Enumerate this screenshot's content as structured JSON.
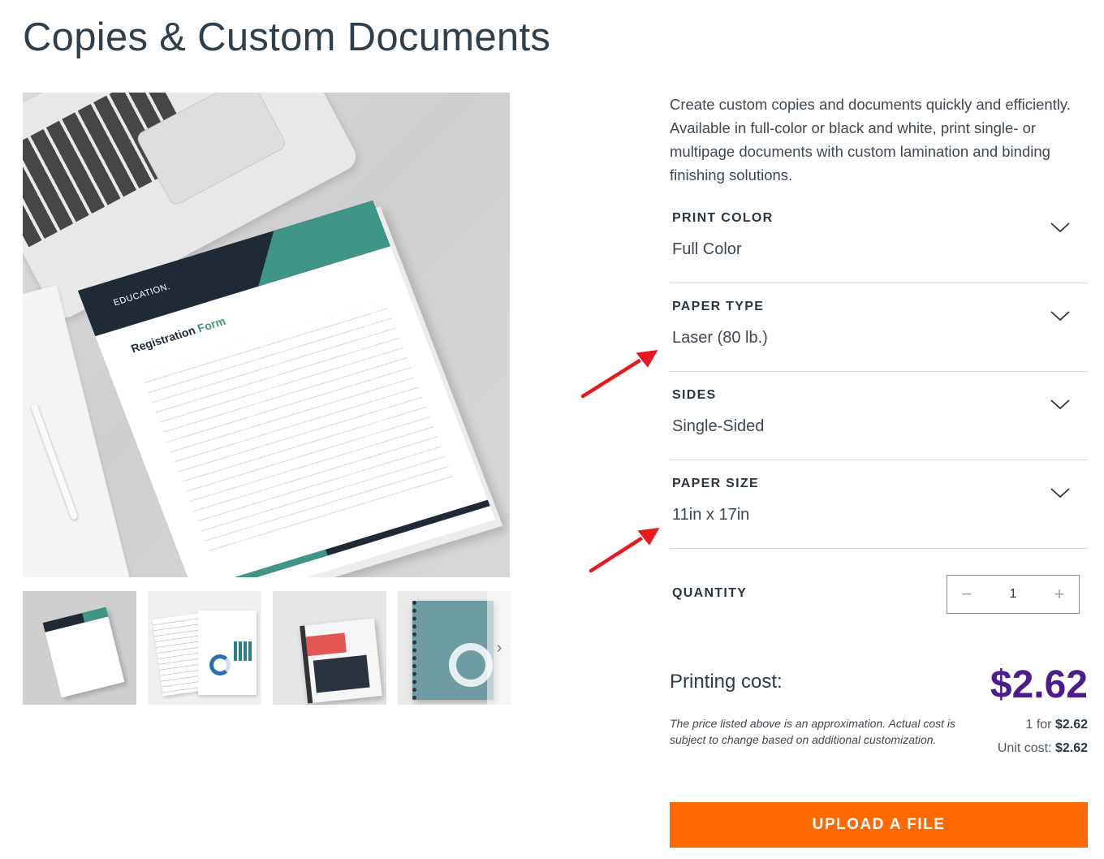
{
  "page": {
    "title": "Copies & Custom Documents"
  },
  "product": {
    "description": "Create custom copies and documents quickly and efficiently. Available in full-color or black and white, print single- or multipage documents with custom lamination and binding finishing solutions.",
    "hero_doc": {
      "brand": "EDUCATION.",
      "title_a": "Registration",
      "title_b": "Form"
    },
    "thumbnails": [
      "registration-form",
      "financial-projection",
      "business-proposal",
      "marketing-proposal"
    ]
  },
  "options": [
    {
      "label": "PRINT COLOR",
      "value": "Full Color"
    },
    {
      "label": "PAPER TYPE",
      "value": "Laser (80 lb.)"
    },
    {
      "label": "SIDES",
      "value": "Single-Sided"
    },
    {
      "label": "PAPER SIZE",
      "value": "11in x 17in"
    }
  ],
  "quantity": {
    "label": "QUANTITY",
    "value": "1",
    "minus": "−",
    "plus": "+"
  },
  "cost": {
    "label": "Printing cost:",
    "price": "$2.62",
    "disclaimer": "The price listed above is an approximation. Actual cost is subject to change based on additional customization.",
    "qty_text": "1 for",
    "qty_price": "$2.62",
    "unit_text": "Unit cost:",
    "unit_price": "$2.62"
  },
  "upload_label": "UPLOAD A FILE",
  "colors": {
    "accent": "#ff6a00",
    "price": "#4b1d8c",
    "annotation_arrow": "#e8191c"
  }
}
